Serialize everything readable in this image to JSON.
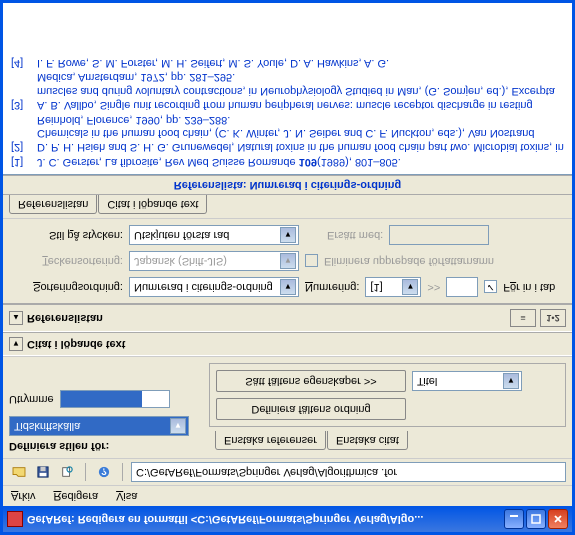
{
  "title": "GetARef: Redigera en formatfil <C:/GetARef/Formats/Springer Verlag/Algo...",
  "menubar": {
    "arkiv": "Arkiv",
    "redigera": "Redigera",
    "visa": "Visa"
  },
  "toolbar": {
    "path": "C:/GetARef/Formats/Springer Verlag/Algorithmica .for"
  },
  "def_style_label": "Definiera stilen för:",
  "leftbox": {
    "dropdown_value": "Tidskriftskälla",
    "subfield_label": "Utrymme"
  },
  "rightbox": {
    "tab1": "Enstaka referenser",
    "tab2": "Enstaka citat",
    "btn_order": "Definiera fältens ordning",
    "btn_props": "Sätt fältens egenskaper >>",
    "prop_field": "Titel"
  },
  "section1": "Citat i löpande text",
  "section2": "Referenslistan",
  "tabs12": {
    "t2": "1•2"
  },
  "opts": {
    "sort_label": "Sorteringsordning:",
    "sort_value": "Numrerad i citerings-ordning",
    "num_label": "Numrering:",
    "num_value": "[1]",
    "dots": ">>",
    "fillin": "För in i tab",
    "charset_label": "Teckensortering:",
    "charset_value": "Japansk (Shift-JIS)",
    "elim": "Eliminera upprepade författarnamn",
    "replace_label": "Ersätt med:",
    "para_label": "Stil på stycken:",
    "para_value": "Utskjuten första rad"
  },
  "subtabs": {
    "t1": "Referenslistan",
    "t2": "Citat i löpande text"
  },
  "refs_header": "Referenslista: Numrerad i citerings-ordning",
  "refs": [
    {
      "n": "[1]",
      "text_pre": "J. C. Gerster, La fibrosite, Rev Med Suisse Romande ",
      "vol": "109",
      "text_post": "(1989), 801–805."
    },
    {
      "n": "[2]",
      "text_pre": "D. P. H. Hsieh and S. H. G. Grunewedel, Natural toxins in the human food chain part two. Microbial toxins, in Chemicals in the human food chain, (C. K. Winter, J. N. Seiber and C. F. Nuckton, eds.), Van Nostrand Reinhold, Florence, 1990, pp. 239–288.",
      "vol": "",
      "text_post": ""
    },
    {
      "n": "[3]",
      "text_pre": "A. B. Vallbo, Single unit recording from human peripheral nerves: muscle receptor discharge in resting muscles and during voluntary contractions, in Neurophysiology Studied in Man, (G. Somjen, ed.), Excerpta Medica, Amsterdam, 1972, pp. 281–295.",
      "vol": "",
      "text_post": ""
    },
    {
      "n": "[4]",
      "text_pre": "I. F. Rowe, S. M. Forster, M. H. Seifert, M. S. Youle, D. A. Hawkins, A. G.",
      "vol": "",
      "text_post": ""
    }
  ]
}
